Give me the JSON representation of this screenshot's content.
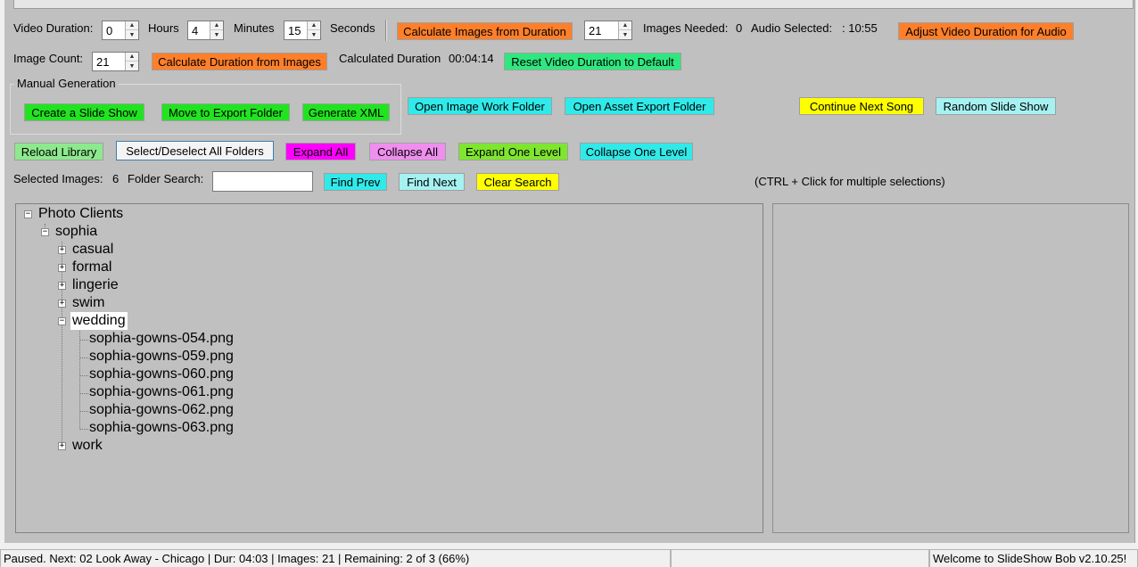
{
  "colors": {
    "orange": "#ff7f2a",
    "green": "#21e421",
    "spring_green": "#2ee87f",
    "cyan": "#30eaea",
    "yellow": "#ffff00",
    "light_cyan": "#a6f2f2",
    "light_green": "#8de98d",
    "magenta": "#ff00ff",
    "violet": "#f08ef0",
    "lime": "#7ee62e",
    "white_button": "#f4f4f4"
  },
  "row1": {
    "video_duration_label": "Video Duration:",
    "hours_value": "0",
    "hours_label": "Hours",
    "minutes_value": "4",
    "minutes_label": "Minutes",
    "seconds_value": "15",
    "seconds_label": "Seconds",
    "calc_images_button": "Calculate Images from Duration",
    "images_spin_value": "21",
    "images_needed_label": "Images Needed:",
    "images_needed_value": "0",
    "audio_selected_label": "Audio Selected:",
    "audio_selected_value": ": 10:55",
    "adjust_duration_button": "Adjust Video Duration for Audio"
  },
  "row2": {
    "image_count_label": "Image Count:",
    "image_count_value": "21",
    "calc_duration_button": "Calculate Duration from Images",
    "calculated_duration_label": "Calculated Duration",
    "calculated_duration_value": "00:04:14",
    "reset_duration_button": "Reset Video Duration to Default"
  },
  "manual_generation": {
    "title": "Manual Generation",
    "create_slide_show": "Create a Slide Show",
    "move_to_export": "Move to Export Folder",
    "generate_xml": "Generate XML"
  },
  "folder_buttons": {
    "open_image_work": "Open Image Work Folder",
    "open_asset_export": "Open Asset Export Folder",
    "continue_next_song": "Continue Next Song",
    "random_slide_show": "Random Slide Show"
  },
  "library_row": {
    "reload_library": "Reload Library",
    "select_deselect_all": "Select/Deselect All Folders",
    "expand_all": "Expand All",
    "collapse_all": "Collapse All",
    "expand_one_level": "Expand One Level",
    "collapse_one_level": "Collapse One Level"
  },
  "search_row": {
    "selected_images_label": "Selected Images:",
    "selected_images_value": "6",
    "folder_search_label": "Folder Search:",
    "folder_search_value": "",
    "find_prev": "Find Prev",
    "find_next": "Find Next",
    "clear_search": "Clear Search",
    "hint": "(CTRL + Click for multiple selections)"
  },
  "tree": {
    "root": "Photo Clients",
    "client": "sophia",
    "folders": {
      "casual": "casual",
      "formal": "formal",
      "lingerie": "lingerie",
      "swim": "swim",
      "wedding": "wedding",
      "work": "work"
    },
    "files": [
      "sophia-gowns-054.png",
      "sophia-gowns-059.png",
      "sophia-gowns-060.png",
      "sophia-gowns-061.png",
      "sophia-gowns-062.png",
      "sophia-gowns-063.png"
    ]
  },
  "status": {
    "left": "Paused. Next: 02 Look Away - Chicago | Dur: 04:03 | Images: 21 | Remaining: 2 of 3 (66%)",
    "middle": "",
    "right": "Welcome to SlideShow Bob v2.10.25!"
  }
}
